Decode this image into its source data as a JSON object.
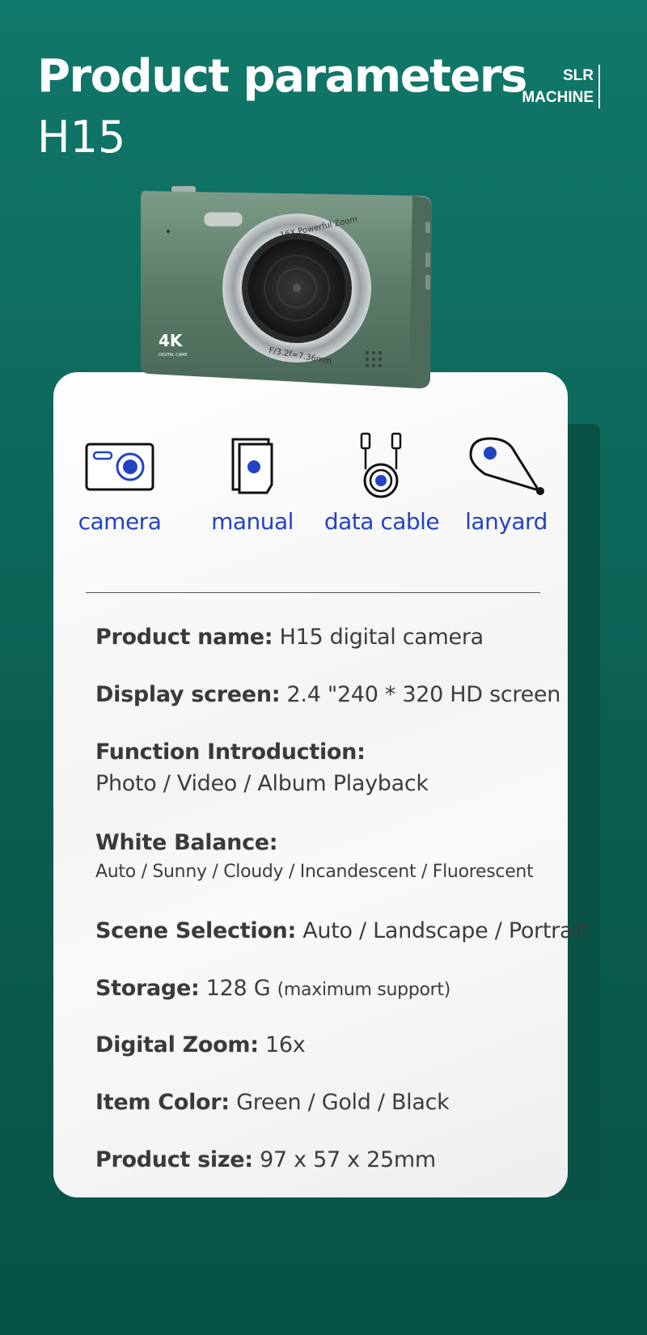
{
  "header": {
    "title": "Product parameters",
    "model": "H15",
    "badge_line1": "SLR",
    "badge_line2": "MACHINE"
  },
  "camera": {
    "lens_text_top": "16X Powerful Zoom",
    "lens_text_bottom": "F/3.2f=7.36mm",
    "badge_4k": "4K",
    "badge_sub": "DIGITAL CAME",
    "body_color": "#5a7a68"
  },
  "accessories": [
    {
      "label": "camera",
      "icon": "camera-icon"
    },
    {
      "label": "manual",
      "icon": "manual-icon"
    },
    {
      "label": "data cable",
      "icon": "data-cable-icon"
    },
    {
      "label": "lanyard",
      "icon": "lanyard-icon"
    }
  ],
  "specs": {
    "product_name": {
      "key": "Product name:",
      "value": "H15 digital camera"
    },
    "display_screen": {
      "key": "Display screen:",
      "value": "2.4 \"240 * 320 HD screen"
    },
    "function_intro": {
      "key": "Function Introduction:",
      "value": "Photo / Video / Album Playback"
    },
    "white_balance": {
      "key": "White Balance:",
      "value": "Auto / Sunny / Cloudy / Incandescent / Fluorescent"
    },
    "scene_selection": {
      "key": "Scene Selection:",
      "value": "Auto / Landscape / Portrait"
    },
    "storage": {
      "key": "Storage:",
      "value": "128 G",
      "note": "(maximum support)"
    },
    "digital_zoom": {
      "key": "Digital Zoom:",
      "value": "16x"
    },
    "item_color": {
      "key": "Item Color:",
      "value": "Green / Gold / Black"
    },
    "product_size": {
      "key": "Product size:",
      "value": "97 x 57 x 25mm"
    }
  },
  "colors": {
    "accent_blue": "#2244c2",
    "bg_green": "#0d6b5e"
  }
}
